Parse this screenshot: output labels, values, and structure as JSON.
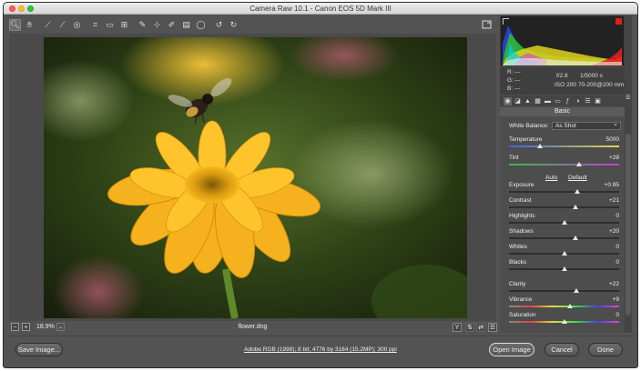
{
  "window": {
    "title": "Camera Raw 10.1  -  Canon EOS 5D Mark III"
  },
  "toolbar": {
    "tools": [
      {
        "name": "zoom-tool",
        "icon": "magnifier-icon",
        "glyph": "🔍︎",
        "active": true
      },
      {
        "name": "hand-tool",
        "icon": "hand-icon",
        "glyph": "✋︎"
      },
      {
        "name": "white-balance-tool",
        "icon": "eyedropper-icon",
        "glyph": "⟋"
      },
      {
        "name": "color-sampler-tool",
        "icon": "color-sampler-icon",
        "glyph": "⟋"
      },
      {
        "name": "targeted-adjustment-tool",
        "icon": "target-adjust-icon",
        "glyph": "◎"
      },
      {
        "name": "crop-tool",
        "icon": "crop-icon",
        "glyph": "⌗"
      },
      {
        "name": "straighten-tool",
        "icon": "straighten-icon",
        "glyph": "▭"
      },
      {
        "name": "transform-tool",
        "icon": "transform-icon",
        "glyph": "⊞"
      },
      {
        "name": "spot-removal-tool",
        "icon": "spot-removal-icon",
        "glyph": "✎"
      },
      {
        "name": "red-eye-tool",
        "icon": "red-eye-icon",
        "glyph": "⊹"
      },
      {
        "name": "adjustment-brush-tool",
        "icon": "brush-icon",
        "glyph": "✐"
      },
      {
        "name": "graduated-filter-tool",
        "icon": "graduated-filter-icon",
        "glyph": "▤"
      },
      {
        "name": "radial-filter-tool",
        "icon": "radial-filter-icon",
        "glyph": "◯"
      },
      {
        "name": "rotate-left-tool",
        "icon": "rotate-ccw-icon",
        "glyph": "↺"
      },
      {
        "name": "rotate-right-tool",
        "icon": "rotate-cw-icon",
        "glyph": "↻"
      }
    ]
  },
  "camera_info": {
    "r": "R:",
    "g": "G:",
    "b": "B:",
    "dashes": "---",
    "aperture": "f/2.8",
    "shutter": "1/5000 s",
    "iso": "ISO 200",
    "lens": "70-200@200 mm"
  },
  "panel": {
    "title": "Basic",
    "white_balance_label": "White Balance:",
    "white_balance_value": "As Shot",
    "auto": "Auto",
    "default": "Default",
    "sliders": [
      {
        "label": "Temperature",
        "value": "5000",
        "pos": 0.28,
        "gradient": "linear-gradient(90deg,#3b63d8,#e8d24a)"
      },
      {
        "label": "Tint",
        "value": "+28",
        "pos": 0.64,
        "gradient": "linear-gradient(90deg,#3bb84a,#c23fd2)"
      },
      {
        "label": "Exposure",
        "value": "+0.95",
        "pos": 0.62
      },
      {
        "label": "Contrast",
        "value": "+21",
        "pos": 0.6
      },
      {
        "label": "Highlights",
        "value": "0",
        "pos": 0.5
      },
      {
        "label": "Shadows",
        "value": "+20",
        "pos": 0.6
      },
      {
        "label": "Whites",
        "value": "0",
        "pos": 0.5
      },
      {
        "label": "Blacks",
        "value": "0",
        "pos": 0.5
      },
      {
        "label": "Clarity",
        "value": "+22",
        "pos": 0.61
      },
      {
        "label": "Vibrance",
        "value": "+9",
        "pos": 0.55,
        "gradient": "linear-gradient(90deg,#888,#d44,#dd4,#4d4,#44d,#d4d)"
      },
      {
        "label": "Saturation",
        "value": "0",
        "pos": 0.5,
        "gradient": "linear-gradient(90deg,#888,#d44,#dd4,#4d4,#44d,#d4d)"
      }
    ]
  },
  "status": {
    "zoom_out": "−",
    "zoom_in": "+",
    "zoom_level": "18.9%",
    "zoom_dropdown": "⌄",
    "filename": "flower.dng",
    "before_after": "Y"
  },
  "bottom": {
    "save": "Save Image...",
    "workflow": "Adobe RGB (1998); 8 bit; 4776 by 3184 (15.2MP); 300 ppi",
    "open": "Open Image",
    "cancel": "Cancel",
    "done": "Done"
  },
  "colors": {
    "accent": "#e01c1c",
    "panel": "#4d4d4d",
    "chrome": "#535353"
  }
}
